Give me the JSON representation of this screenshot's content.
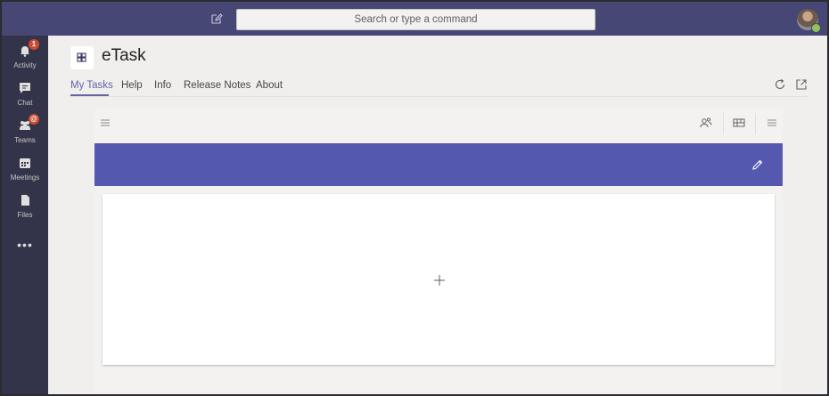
{
  "topbar": {
    "search_placeholder": "Search or type a command",
    "compose_icon": "compose-icon",
    "avatar_icon": "user-avatar",
    "presence_color": "#92c353"
  },
  "rail": {
    "items": [
      {
        "label": "Activity",
        "icon": "bell-icon",
        "badge": "1"
      },
      {
        "label": "Chat",
        "icon": "chat-icon",
        "badge": ""
      },
      {
        "label": "Teams",
        "icon": "teams-icon",
        "badge": "@"
      },
      {
        "label": "Meetings",
        "icon": "calendar-icon",
        "badge": ""
      },
      {
        "label": "Files",
        "icon": "file-icon",
        "badge": ""
      }
    ],
    "more_label": "•••"
  },
  "app": {
    "title": "eTask",
    "tabs": [
      {
        "label": "My Tasks",
        "active": true
      },
      {
        "label": "Help",
        "active": false
      },
      {
        "label": "Info",
        "active": false
      },
      {
        "label": "Release Notes",
        "active": false
      },
      {
        "label": "About",
        "active": false
      }
    ]
  },
  "colors": {
    "topbar": "#464775",
    "rail": "#33344a",
    "accent": "#6264a7",
    "banner": "#5558af",
    "badge": "#cc4a31"
  }
}
